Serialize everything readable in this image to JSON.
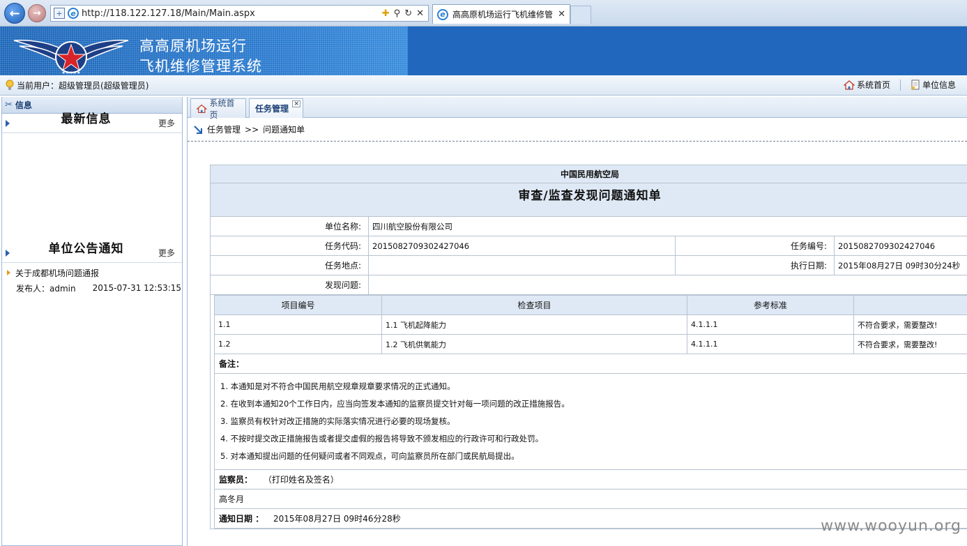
{
  "browser": {
    "url": "http://118.122.127.18/Main/Main.aspx",
    "tab_title": "高高原机场运行飞机维修管...",
    "tab_close": "✕"
  },
  "banner": {
    "title_line1": "高高原机场运行",
    "title_line2": "飞机维修管理系统"
  },
  "userbar": {
    "current_user_label": "当前用户：",
    "current_user": "超级管理员(超级管理员)",
    "nav_home": "系统首页",
    "nav_unit_info": "单位信息"
  },
  "left": {
    "header": "信息",
    "latest_title": "最新信息",
    "latest_more": "更多",
    "notices_title": "单位公告通知",
    "notices_more": "更多",
    "notices": [
      {
        "title": "关于成都机场问题通报",
        "publisher": "发布人：admin",
        "time": "2015-07-31 12:53:15"
      }
    ]
  },
  "tabs": {
    "home": "系统首页",
    "task": "任务管理",
    "task_close": "×"
  },
  "breadcrumb": {
    "level1": "任务管理",
    "sep": ">>",
    "level2": "问题通知单"
  },
  "form": {
    "org": "中国民用航空局",
    "title": "审查/监查发现问题通知单",
    "unit_label": "单位名称:",
    "unit_value": "四川航空股份有限公司",
    "task_code_label": "任务代码:",
    "task_code_value": "2015082709302427046",
    "task_no_label": "任务编号:",
    "task_no_value": "2015082709302427046",
    "task_place_label": "任务地点:",
    "task_place_value": "",
    "exec_date_label": "执行日期:",
    "exec_date_value": "2015年08月27日 09时30分24秒",
    "found_label": "发现问题:",
    "columns": [
      "项目编号",
      "检查项目",
      "参考标准",
      ""
    ],
    "rows": [
      [
        "1.1",
        "1.1 飞机起降能力",
        "4.1.1.1",
        "不符合要求，需要整改!"
      ],
      [
        "1.2",
        "1.2 飞机供氧能力",
        "4.1.1.1",
        "不符合要求，需要整改!"
      ]
    ],
    "remark_label": "备注：",
    "notes": [
      "1. 本通知是对不符合中国民用航空规章规章要求情况的正式通知。",
      "2. 在收到本通知20个工作日内，应当向签发本通知的监察员提交针对每一项问题的改正措施报告。",
      "3. 监察员有权针对改正措施的实际落实情况进行必要的现场复核。",
      "4. 不按时提交改正措施报告或者提交虚假的报告将导致不颁发相应的行政许可和行政处罚。",
      "5. 对本通知提出问题的任何疑问或者不同观点，可向监察员所在部门或民航局提出。"
    ],
    "inspector_label": "监察员：",
    "inspector_hint": "（打印姓名及签名）",
    "inspector_name": "高冬月",
    "notify_date_label": "通知日期 ：",
    "notify_date_value": "2015年08月27日 09时46分28秒"
  },
  "watermark": "www.wooyun.org",
  "colors": {
    "banner_blue": "#2a7bd0",
    "header_blue": "#dfe9f5",
    "accent_dark": "#1b3f73"
  }
}
